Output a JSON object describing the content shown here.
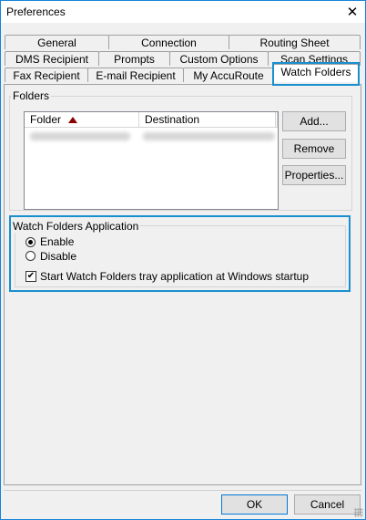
{
  "window": {
    "title": "Preferences",
    "close_glyph": "✕"
  },
  "tabs": {
    "row1": [
      "General",
      "Connection",
      "Routing Sheet"
    ],
    "row2": [
      "DMS Recipient",
      "Prompts",
      "Custom Options",
      "Scan Settings"
    ],
    "row3": [
      "Fax Recipient",
      "E-mail Recipient",
      "My AccuRoute",
      "Watch Folders"
    ],
    "active": "Watch Folders"
  },
  "folders": {
    "group_label": "Folders",
    "columns": [
      "Folder",
      "Destination"
    ],
    "sort_indicator": "ascending",
    "buttons": {
      "add": "Add...",
      "remove": "Remove",
      "properties": "Properties..."
    }
  },
  "watch_folders_application": {
    "group_label": "Watch Folders Application",
    "options": {
      "enable": "Enable",
      "disable": "Disable"
    },
    "selected": "Enable",
    "startup_checkbox": {
      "label": "Start Watch Folders tray application at Windows startup",
      "checked": true
    }
  },
  "footer": {
    "ok": "OK",
    "cancel": "Cancel"
  },
  "colors": {
    "highlight": "#1a8fce",
    "sort_arrow": "#8b0000"
  }
}
